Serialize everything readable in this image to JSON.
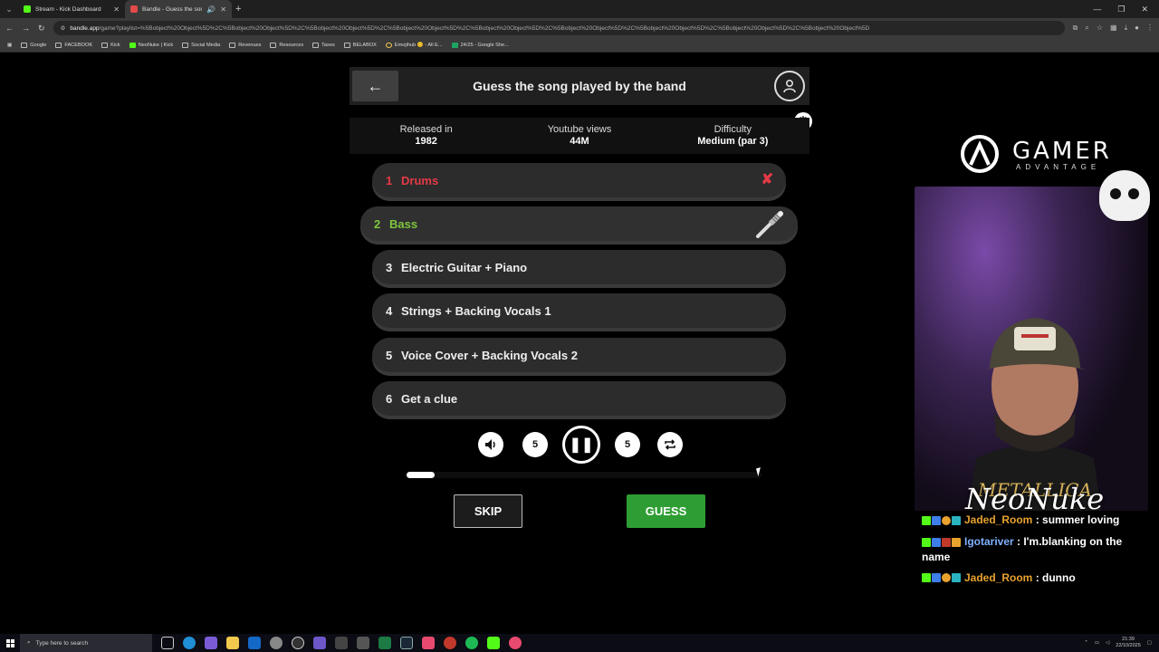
{
  "browser": {
    "tabs": [
      {
        "title": "Stream - Kick Dashboard",
        "active": false,
        "favicon_color": "#53fc18"
      },
      {
        "title": "Bandle - Guess the song, on",
        "active": true,
        "favicon_color": "#e24a4a"
      }
    ],
    "url_host": "bandle.app",
    "url_path": "/game?playlist=%5Bobject%20Object%5D%2C%5Bobject%20Object%5D%2C%5Bobject%20Object%5D%2C%5Bobject%20Object%5D%2C%5Bobject%20Object%5D%2C%5Bobject%20Object%5D%2C%5Bobject%20Object%5D%2C%5Bobject%20Object%5D%2C%5Bobject%20Object%5D",
    "bookmarks": [
      "Google",
      "FACEBOOK",
      "Kick",
      "NeoNuke | Kick",
      "Social Media",
      "Revenues",
      "Resources",
      "Taxes",
      "BELABOX",
      "Emojihub 😊 - All E...",
      "24/25 - Google She..."
    ]
  },
  "game": {
    "title": "Guess the song played by the band",
    "info": [
      {
        "label": "Released in",
        "value": "1982"
      },
      {
        "label": "Youtube views",
        "value": "44M"
      },
      {
        "label": "Difficulty",
        "value": "Medium (par 3)"
      }
    ],
    "tracks": [
      {
        "num": "1",
        "label": "Drums",
        "state": "failed"
      },
      {
        "num": "2",
        "label": "Bass",
        "state": "current"
      },
      {
        "num": "3",
        "label": "Electric Guitar + Piano",
        "state": "locked"
      },
      {
        "num": "4",
        "label": "Strings + Backing Vocals 1",
        "state": "locked"
      },
      {
        "num": "5",
        "label": "Voice Cover + Backing Vocals 2",
        "state": "locked"
      },
      {
        "num": "6",
        "label": "Get a clue",
        "state": "locked"
      }
    ],
    "controls": {
      "volume_icon": "volume-icon",
      "rewind_label": "5",
      "play_icon": "pause-icon",
      "forward_label": "5",
      "repeat_icon": "repeat-icon"
    },
    "progress": 0.08,
    "skip_label": "SKIP",
    "guess_label": "GUESS",
    "colors": {
      "failed": "#e63946",
      "current": "#7ec63f",
      "guess": "#2e9e34"
    }
  },
  "overlay": {
    "brand_name": "GAMER",
    "brand_sub": "ADVANTAGE",
    "streamer_name": "NeoNuke",
    "shirt_text": "METALLICA",
    "chat": [
      {
        "user": "Jaded_Room",
        "message": " : summer loving",
        "color": "#e8a22e"
      },
      {
        "user": "Igotariver",
        "message": " : I'm.blanking on the name",
        "color": "#7fb0ff"
      },
      {
        "user": "Jaded_Room",
        "message": " : dunno",
        "color": "#e8a22e"
      }
    ]
  },
  "taskbar": {
    "search_placeholder": "Type here to search",
    "time": "21:39",
    "date": "22/10/2025"
  }
}
